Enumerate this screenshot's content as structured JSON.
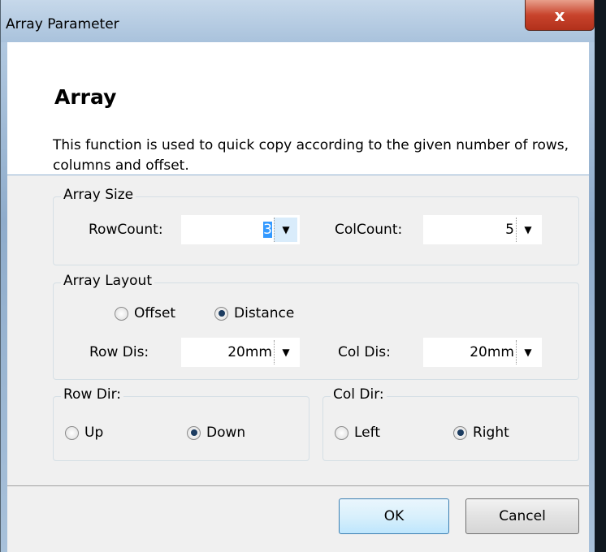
{
  "window": {
    "title": "Array Parameter",
    "close_glyph": "x"
  },
  "header": {
    "title": "Array",
    "description": "This function is used to quick copy according to the given number of rows, columns and offset."
  },
  "array_size": {
    "legend": "Array Size",
    "row_count_label": "RowCount:",
    "row_count_value": "3",
    "col_count_label": "ColCount:",
    "col_count_value": "5"
  },
  "array_layout": {
    "legend": "Array Layout",
    "offset_label": "Offset",
    "distance_label": "Distance",
    "selected": "Distance",
    "row_dis_label": "Row Dis:",
    "row_dis_value": "20mm",
    "col_dis_label": "Col Dis:",
    "col_dis_value": "20mm"
  },
  "row_dir": {
    "legend": "Row Dir:",
    "up_label": "Up",
    "down_label": "Down",
    "selected": "Down"
  },
  "col_dir": {
    "legend": "Col Dir:",
    "left_label": "Left",
    "right_label": "Right",
    "selected": "Right"
  },
  "buttons": {
    "ok": "OK",
    "cancel": "Cancel"
  },
  "icons": {
    "dropdown": "chevron-down-icon",
    "close": "close-icon"
  }
}
